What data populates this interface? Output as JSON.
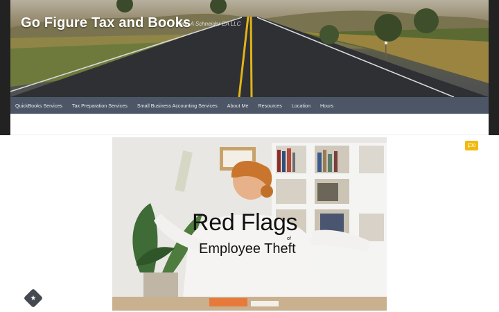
{
  "site": {
    "title": "Go Figure Tax and Books",
    "tagline": "Anna A Schneider EA LLC"
  },
  "nav": {
    "items": [
      {
        "label": "QuickBooks Services"
      },
      {
        "label": "Tax Preparation Services"
      },
      {
        "label": "Small Business Accounting Services"
      },
      {
        "label": "About Me"
      },
      {
        "label": "Resources"
      },
      {
        "label": "Location"
      },
      {
        "label": "Hours"
      }
    ]
  },
  "post": {
    "comment_count": "0",
    "image_title": "Red Flags",
    "image_subtitle_small": "of",
    "image_subtitle": "Employee Theft"
  },
  "icons": {
    "comment": "comment-bubble-icon",
    "floating": "star-icon"
  },
  "colors": {
    "nav_bg": "#4d5666",
    "accent": "#f2b90c",
    "frame": "#222222"
  }
}
